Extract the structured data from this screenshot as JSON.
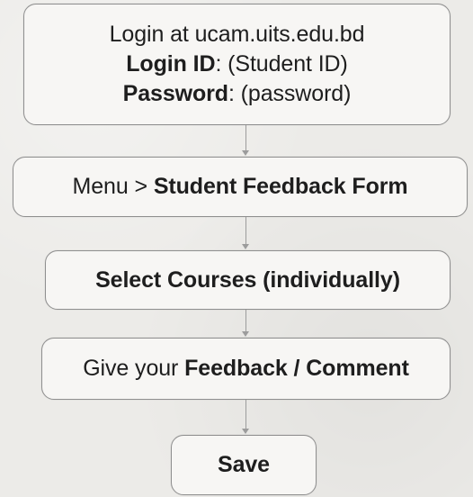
{
  "flow": {
    "step1": {
      "line1": "Login at ucam.uits.edu.bd",
      "login_label": "Login ID",
      "login_value": ": (Student ID)",
      "password_label": "Password",
      "password_value": ": (password)"
    },
    "step2": {
      "prefix": "Menu > ",
      "emphasis": "Student Feedback Form"
    },
    "step3": {
      "text": "Select Courses (individually)"
    },
    "step4": {
      "prefix": "Give your ",
      "emphasis": "Feedback / Comment"
    },
    "step5": {
      "text": "Save"
    }
  },
  "colors": {
    "background": "#ecebe8",
    "box_fill": "#f7f6f4",
    "box_border": "#8f8f8f",
    "connector": "#9c9c9c",
    "text": "#1e1e1e"
  }
}
